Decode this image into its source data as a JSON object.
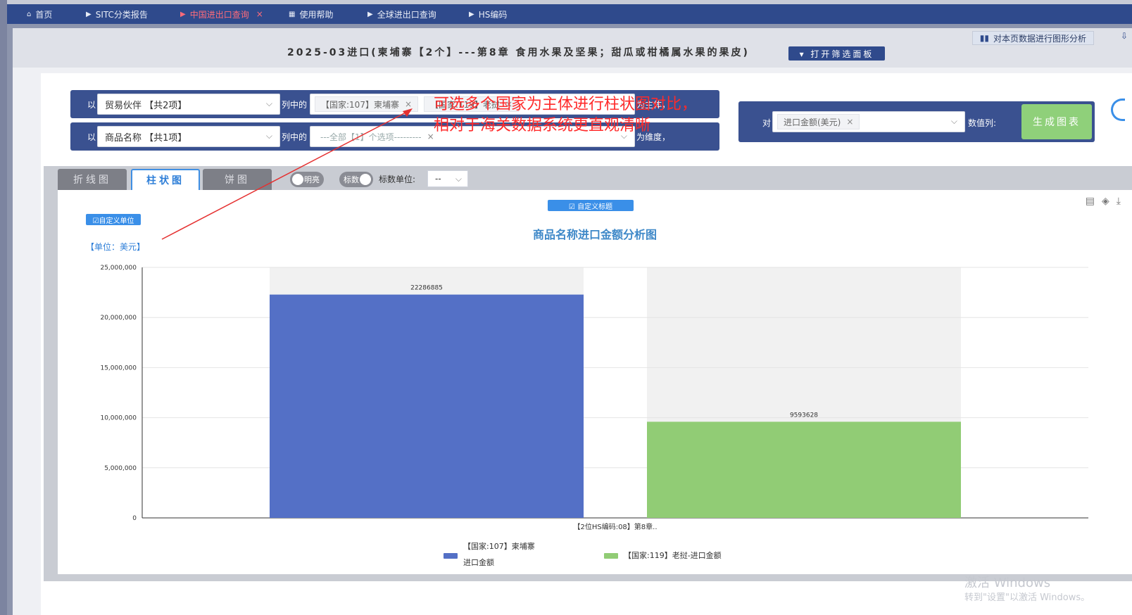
{
  "nav": {
    "items": [
      {
        "label": "首页",
        "glyph": "⌂"
      },
      {
        "label": "SITC分类报告",
        "glyph": "▶"
      },
      {
        "label": "中国进出口查询",
        "glyph": "▶",
        "close": "×"
      },
      {
        "label": "使用帮助",
        "glyph": "▦"
      },
      {
        "label": "全球进出口查询",
        "glyph": "▶"
      },
      {
        "label": "HS编码",
        "glyph": "▶"
      }
    ]
  },
  "header": {
    "title": "2025-03进口(柬埔寨【2个】---第8章 食用水果及坚果；甜瓜或柑橘属水果的果皮)",
    "filter_button": "▾ 打开筛选面板",
    "analyze_button": "对本页数据进行图形分析",
    "download_glyph": "⇩"
  },
  "annotation": {
    "line1": "可选多个国家为主体进行柱状图对比，",
    "line2": "相对于海关数据系统更直观清晰"
  },
  "filters": {
    "row1": {
      "prefix": "以",
      "select_value": "贸易伙伴 【共2项】",
      "middle": "列中的",
      "tags": [
        "【国家:107】柬埔寨",
        "【国家:119】老挝"
      ],
      "suffix": "为主体，"
    },
    "row2": {
      "prefix": "以",
      "select_value": "商品名称 【共1项】",
      "middle": "列中的",
      "tags": [
        "---全部【1】个选项---------"
      ],
      "suffix": "为维度，"
    },
    "value": {
      "prefix": "对",
      "tag": "进口金额(美元)",
      "suffix": "数值列:",
      "generate_button": "生成图表"
    },
    "tag_close": "×",
    "chevron": "⌵"
  },
  "chart_tabs": {
    "tabs": [
      "折线图",
      "柱状图",
      "饼图"
    ],
    "active_index": 1,
    "toggle_bright": "明亮",
    "toggle_label": "标数",
    "unit_label": "标数单位:",
    "unit_value": "--"
  },
  "chart_panel": {
    "custom_title_button": "☑ 自定义标题",
    "custom_unit_button": "☑自定义单位",
    "unit_note": "【单位：美元】",
    "tools": [
      "▤",
      "◈",
      "⤓"
    ]
  },
  "chart_data": {
    "type": "bar",
    "title": "商品名称进口金额分析图",
    "categories": [
      "【2位HS编码:08】第8章.."
    ],
    "series": [
      {
        "name": "【国家:107】柬埔寨进口金额",
        "legend_line1": "【国家:107】柬埔寨",
        "legend_line2": "进口金额",
        "values": [
          22286885
        ],
        "color": "#5470c6"
      },
      {
        "name": "【国家:119】老挝-进口金额",
        "values": [
          9593628
        ],
        "color": "#91cc75"
      }
    ],
    "ylim": [
      0,
      25000000
    ],
    "yticks": [
      "0",
      "5,000,000",
      "10,000,000",
      "15,000,000",
      "20,000,000",
      "25,000,000"
    ],
    "ytick_values": [
      0,
      5000000,
      10000000,
      15000000,
      20000000,
      25000000
    ],
    "grid": true,
    "legend_position": "bottom"
  },
  "watermark": {
    "line1": "激活 Windows",
    "line2": "转到\"设置\"以激活 Windows。"
  }
}
